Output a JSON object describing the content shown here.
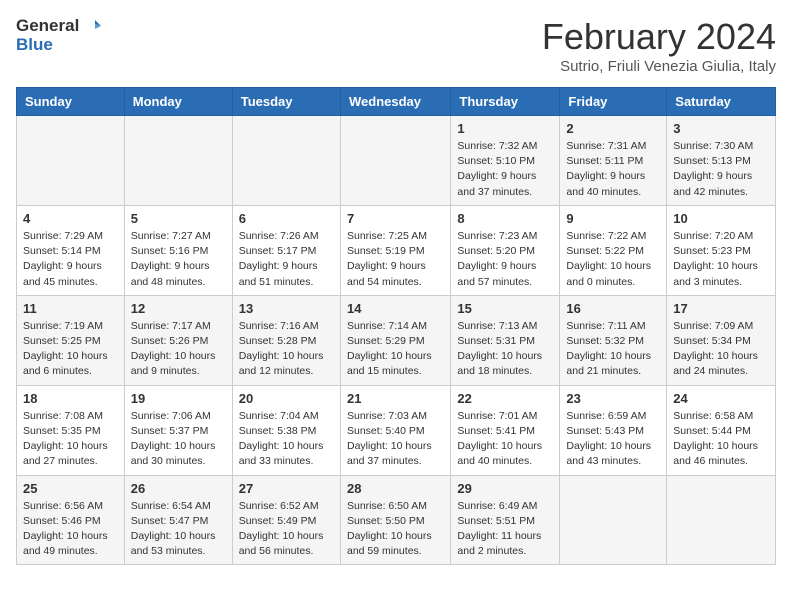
{
  "header": {
    "logo_general": "General",
    "logo_blue": "Blue",
    "month_title": "February 2024",
    "subtitle": "Sutrio, Friuli Venezia Giulia, Italy"
  },
  "weekdays": [
    "Sunday",
    "Monday",
    "Tuesday",
    "Wednesday",
    "Thursday",
    "Friday",
    "Saturday"
  ],
  "weeks": [
    [
      {
        "day": "",
        "info": ""
      },
      {
        "day": "",
        "info": ""
      },
      {
        "day": "",
        "info": ""
      },
      {
        "day": "",
        "info": ""
      },
      {
        "day": "1",
        "info": "Sunrise: 7:32 AM\nSunset: 5:10 PM\nDaylight: 9 hours and 37 minutes."
      },
      {
        "day": "2",
        "info": "Sunrise: 7:31 AM\nSunset: 5:11 PM\nDaylight: 9 hours and 40 minutes."
      },
      {
        "day": "3",
        "info": "Sunrise: 7:30 AM\nSunset: 5:13 PM\nDaylight: 9 hours and 42 minutes."
      }
    ],
    [
      {
        "day": "4",
        "info": "Sunrise: 7:29 AM\nSunset: 5:14 PM\nDaylight: 9 hours and 45 minutes."
      },
      {
        "day": "5",
        "info": "Sunrise: 7:27 AM\nSunset: 5:16 PM\nDaylight: 9 hours and 48 minutes."
      },
      {
        "day": "6",
        "info": "Sunrise: 7:26 AM\nSunset: 5:17 PM\nDaylight: 9 hours and 51 minutes."
      },
      {
        "day": "7",
        "info": "Sunrise: 7:25 AM\nSunset: 5:19 PM\nDaylight: 9 hours and 54 minutes."
      },
      {
        "day": "8",
        "info": "Sunrise: 7:23 AM\nSunset: 5:20 PM\nDaylight: 9 hours and 57 minutes."
      },
      {
        "day": "9",
        "info": "Sunrise: 7:22 AM\nSunset: 5:22 PM\nDaylight: 10 hours and 0 minutes."
      },
      {
        "day": "10",
        "info": "Sunrise: 7:20 AM\nSunset: 5:23 PM\nDaylight: 10 hours and 3 minutes."
      }
    ],
    [
      {
        "day": "11",
        "info": "Sunrise: 7:19 AM\nSunset: 5:25 PM\nDaylight: 10 hours and 6 minutes."
      },
      {
        "day": "12",
        "info": "Sunrise: 7:17 AM\nSunset: 5:26 PM\nDaylight: 10 hours and 9 minutes."
      },
      {
        "day": "13",
        "info": "Sunrise: 7:16 AM\nSunset: 5:28 PM\nDaylight: 10 hours and 12 minutes."
      },
      {
        "day": "14",
        "info": "Sunrise: 7:14 AM\nSunset: 5:29 PM\nDaylight: 10 hours and 15 minutes."
      },
      {
        "day": "15",
        "info": "Sunrise: 7:13 AM\nSunset: 5:31 PM\nDaylight: 10 hours and 18 minutes."
      },
      {
        "day": "16",
        "info": "Sunrise: 7:11 AM\nSunset: 5:32 PM\nDaylight: 10 hours and 21 minutes."
      },
      {
        "day": "17",
        "info": "Sunrise: 7:09 AM\nSunset: 5:34 PM\nDaylight: 10 hours and 24 minutes."
      }
    ],
    [
      {
        "day": "18",
        "info": "Sunrise: 7:08 AM\nSunset: 5:35 PM\nDaylight: 10 hours and 27 minutes."
      },
      {
        "day": "19",
        "info": "Sunrise: 7:06 AM\nSunset: 5:37 PM\nDaylight: 10 hours and 30 minutes."
      },
      {
        "day": "20",
        "info": "Sunrise: 7:04 AM\nSunset: 5:38 PM\nDaylight: 10 hours and 33 minutes."
      },
      {
        "day": "21",
        "info": "Sunrise: 7:03 AM\nSunset: 5:40 PM\nDaylight: 10 hours and 37 minutes."
      },
      {
        "day": "22",
        "info": "Sunrise: 7:01 AM\nSunset: 5:41 PM\nDaylight: 10 hours and 40 minutes."
      },
      {
        "day": "23",
        "info": "Sunrise: 6:59 AM\nSunset: 5:43 PM\nDaylight: 10 hours and 43 minutes."
      },
      {
        "day": "24",
        "info": "Sunrise: 6:58 AM\nSunset: 5:44 PM\nDaylight: 10 hours and 46 minutes."
      }
    ],
    [
      {
        "day": "25",
        "info": "Sunrise: 6:56 AM\nSunset: 5:46 PM\nDaylight: 10 hours and 49 minutes."
      },
      {
        "day": "26",
        "info": "Sunrise: 6:54 AM\nSunset: 5:47 PM\nDaylight: 10 hours and 53 minutes."
      },
      {
        "day": "27",
        "info": "Sunrise: 6:52 AM\nSunset: 5:49 PM\nDaylight: 10 hours and 56 minutes."
      },
      {
        "day": "28",
        "info": "Sunrise: 6:50 AM\nSunset: 5:50 PM\nDaylight: 10 hours and 59 minutes."
      },
      {
        "day": "29",
        "info": "Sunrise: 6:49 AM\nSunset: 5:51 PM\nDaylight: 11 hours and 2 minutes."
      },
      {
        "day": "",
        "info": ""
      },
      {
        "day": "",
        "info": ""
      }
    ]
  ]
}
